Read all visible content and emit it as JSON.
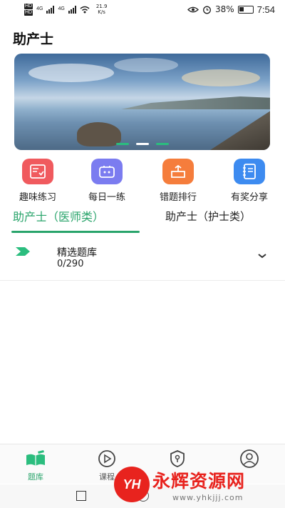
{
  "status_bar": {
    "left_badges": [
      "HD",
      "HD"
    ],
    "network_tags": [
      "4G",
      "4G"
    ],
    "net_speed_value": "21.9",
    "net_speed_unit": "K/s",
    "battery": "38%",
    "time": "7:54",
    "icons": [
      "eye-icon",
      "alarm-icon",
      "battery-icon"
    ]
  },
  "header": {
    "title": "助产士"
  },
  "banner": {
    "slide_count": 3,
    "active_slide": 2
  },
  "shortcuts": [
    {
      "label": "趣味练习",
      "icon": "quiz-board-icon",
      "color": "#f05a5e"
    },
    {
      "label": "每日一练",
      "icon": "daily-practice-icon",
      "color": "#7b7cf0"
    },
    {
      "label": "错题排行",
      "icon": "wrong-questions-icon",
      "color": "#f57d3c"
    },
    {
      "label": "有奖分享",
      "icon": "notebook-share-icon",
      "color": "#3d8bf0"
    }
  ],
  "tabs": [
    {
      "label": "助产士（医师类）",
      "active": true
    },
    {
      "label": "助产士（护士类）",
      "active": false
    }
  ],
  "question_bank": {
    "title": "精选题库",
    "progress": "0/290",
    "icon": "green-flag-icon"
  },
  "bottom_nav": [
    {
      "label": "题库",
      "icon": "book-icon",
      "active": true
    },
    {
      "label": "课程",
      "icon": "play-icon",
      "active": false
    },
    {
      "label": "",
      "icon": "shield-key-icon",
      "active": false
    },
    {
      "label": "",
      "icon": "user-icon",
      "active": false
    }
  ],
  "watermark": {
    "logo": "YH",
    "name": "永辉资源网",
    "url": "www.yhkjjj.com"
  },
  "colors": {
    "accent": "#29a46b",
    "flag": "#2bbd7e",
    "watermark": "#e8231e"
  }
}
